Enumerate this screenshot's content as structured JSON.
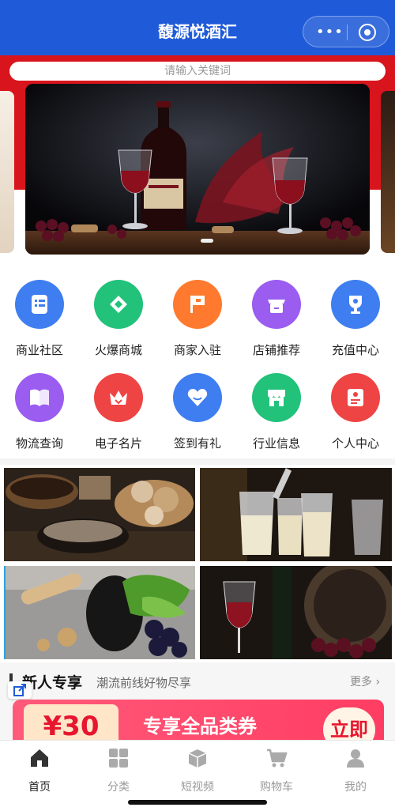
{
  "header": {
    "title": "馥源悦酒汇",
    "menu_icon": "more-dots-icon",
    "close_icon": "target-circle-icon"
  },
  "search": {
    "placeholder": "请输入关键词"
  },
  "colors": {
    "header": "#1f5bd8",
    "banner_red": "#d8141c",
    "accent_red": "#e7162e"
  },
  "grid": {
    "items": [
      {
        "label": "商业社区",
        "icon": "community-doc-icon",
        "color": "#3f7ef0"
      },
      {
        "label": "火爆商城",
        "icon": "tag-icon",
        "color": "#22c27a"
      },
      {
        "label": "商家入驻",
        "icon": "flag-icon",
        "color": "#ff7a2e"
      },
      {
        "label": "店铺推荐",
        "icon": "shop-icon",
        "color": "#9b5cf0"
      },
      {
        "label": "充值中心",
        "icon": "trophy-icon",
        "color": "#3f7ef0"
      },
      {
        "label": "物流查询",
        "icon": "book-icon",
        "color": "#9b5cf0"
      },
      {
        "label": "电子名片",
        "icon": "crown-icon",
        "color": "#ef4444"
      },
      {
        "label": "签到有礼",
        "icon": "heart-icon",
        "color": "#3f7ef0"
      },
      {
        "label": "行业信息",
        "icon": "store-icon",
        "color": "#22c27a"
      },
      {
        "label": "个人中心",
        "icon": "profile-card-icon",
        "color": "#ef4444"
      }
    ]
  },
  "new_section": {
    "title": "新人专享",
    "subtitle": "潮流前线好物尽享",
    "more": "更多 ›"
  },
  "coupon": {
    "amount": "¥30",
    "text": "专享全品类券",
    "button": "立即"
  },
  "tabbar": {
    "items": [
      {
        "label": "首页",
        "icon": "home-icon",
        "active": true
      },
      {
        "label": "分类",
        "icon": "category-grid-icon",
        "active": false
      },
      {
        "label": "短视频",
        "icon": "video-box-icon",
        "active": false
      },
      {
        "label": "购物车",
        "icon": "cart-icon",
        "active": false
      },
      {
        "label": "我的",
        "icon": "user-icon",
        "active": false
      }
    ]
  }
}
